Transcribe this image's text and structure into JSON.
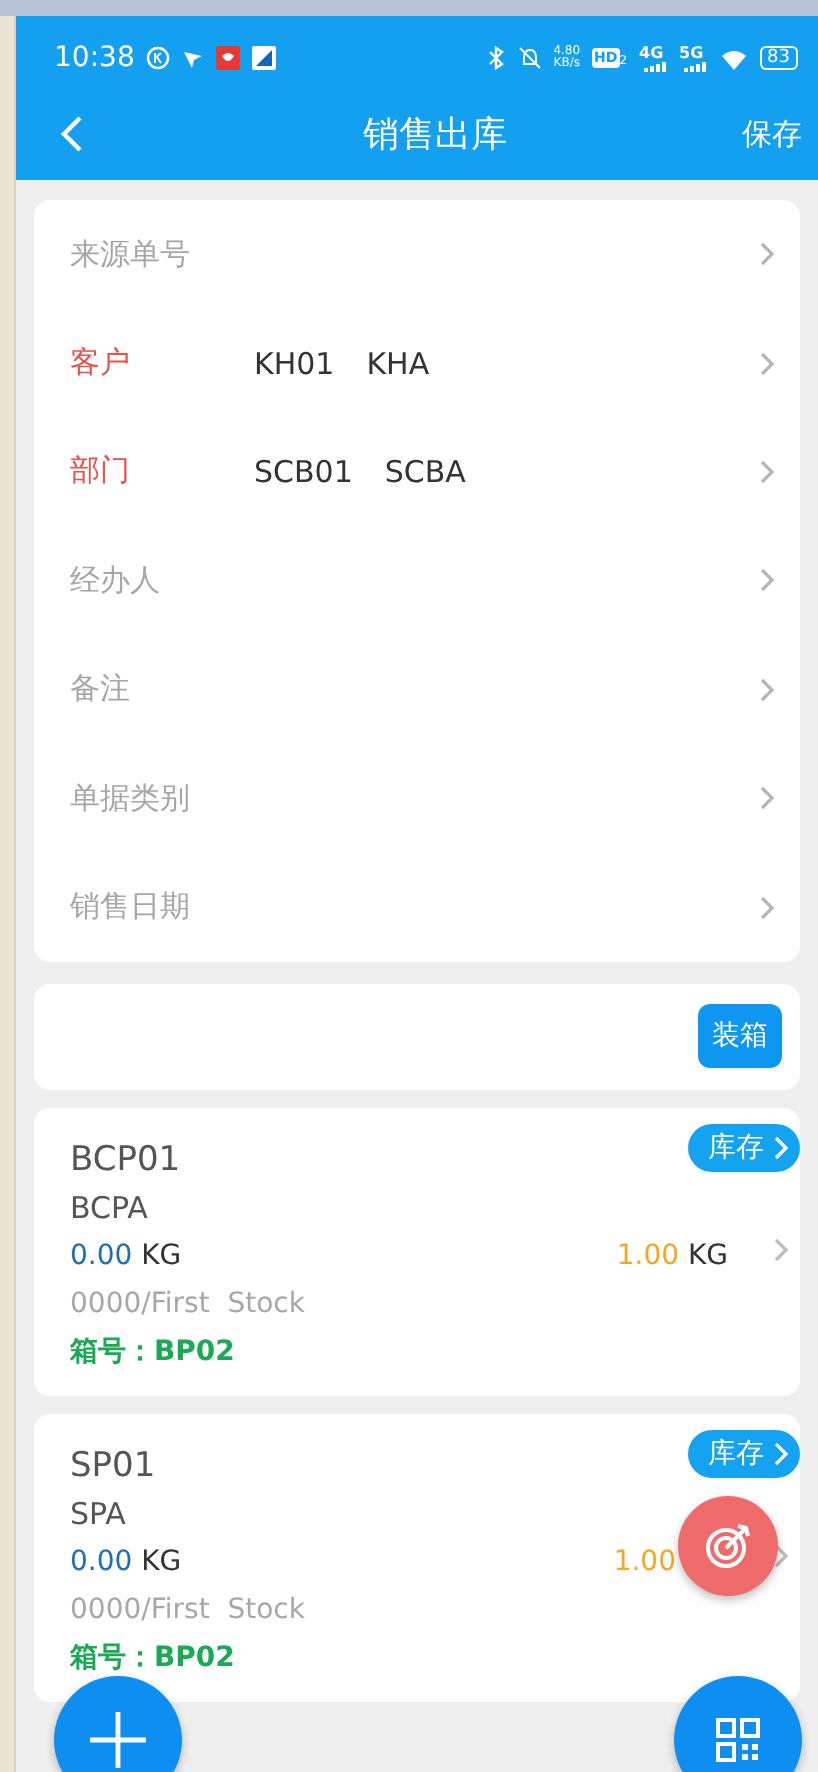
{
  "status_bar": {
    "time": "10:38",
    "net_speed": "4.80",
    "net_speed_unit": "KB/s",
    "hd_label": "HD",
    "hd_sub": "2",
    "sim1_label": "4G",
    "sim2_label": "5G",
    "battery": "83"
  },
  "nav": {
    "title": "销售出库",
    "action": "保存"
  },
  "form": {
    "fields": [
      {
        "label": "来源单号",
        "required": false
      },
      {
        "label": "客户",
        "required": true,
        "code": "KH01",
        "name": "KHA"
      },
      {
        "label": "部门",
        "required": true,
        "code": "SCB01",
        "name": "SCBA"
      },
      {
        "label": "经办人",
        "required": false
      },
      {
        "label": "备注",
        "required": false
      },
      {
        "label": "单据类别",
        "required": false
      },
      {
        "label": "销售日期",
        "required": false
      }
    ]
  },
  "packing": {
    "button": "装箱"
  },
  "items": [
    {
      "code": "BCP01",
      "name": "BCPA",
      "qty": "0.00",
      "qty_unit": "KG",
      "stock_qty": "1.00",
      "stock_unit": "KG",
      "location": "0000/First  Stock",
      "box_label": "箱号：",
      "box_no": "BP02",
      "stock_button": "库存"
    },
    {
      "code": "SP01",
      "name": "SPA",
      "qty": "0.00",
      "qty_unit": "KG",
      "stock_qty": "1.00",
      "location": "0000/First  Stock",
      "box_label": "箱号：",
      "box_no": "BP02",
      "stock_button": "库存"
    }
  ]
}
